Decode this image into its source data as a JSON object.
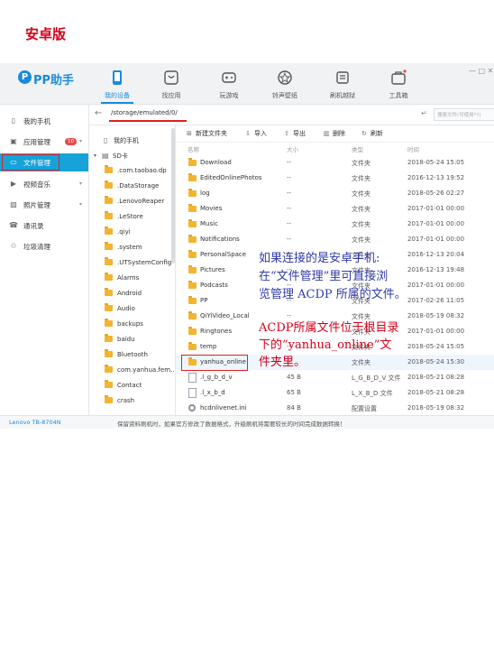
{
  "header": {
    "logo_letter": "P",
    "app_name": "PP助手",
    "edition_overlay": "安卓版",
    "nav": [
      {
        "label": "我的设备",
        "icon": "phone-icon",
        "active": true
      },
      {
        "label": "找应用",
        "icon": "app-store-icon",
        "active": false
      },
      {
        "label": "玩游戏",
        "icon": "gamepad-icon",
        "active": false
      },
      {
        "label": "铃声壁纸",
        "icon": "ringtone-icon",
        "active": false
      },
      {
        "label": "刷机越狱",
        "icon": "flash-icon",
        "active": false
      },
      {
        "label": "工具箱",
        "icon": "toolbox-icon",
        "active": false
      }
    ],
    "window_controls": "— □ ✕"
  },
  "sidebar": {
    "items": [
      {
        "label": "我的手机",
        "icon": "phone-icon"
      },
      {
        "label": "应用管理",
        "icon": "apps-icon",
        "badge": "10"
      },
      {
        "label": "文件管理",
        "icon": "folder-icon",
        "active": true
      },
      {
        "label": "视频音乐",
        "icon": "video-icon"
      },
      {
        "label": "照片管理",
        "icon": "photo-icon"
      },
      {
        "label": "通讯录",
        "icon": "contacts-icon"
      },
      {
        "label": "垃圾清理",
        "icon": "cleanup-icon"
      }
    ]
  },
  "pathbar": {
    "back": "←",
    "path": "/storage/emulated/0/",
    "enter": "↵",
    "search_placeholder": "搜索文件(可使用*?)"
  },
  "tree": {
    "my_phone": "我的手机",
    "sd_card": "SD卡",
    "folders": [
      ".com.taobao.dp",
      ".DataStorage",
      ".LenovoReaper",
      ".LeStore",
      ".qiyi",
      ".system",
      ".UTSystemConfig",
      "Alarms",
      "Android",
      "Audio",
      "backups",
      "baidu",
      "Bluetooth",
      "com.yanhua.fem...",
      "Contact",
      "crash"
    ]
  },
  "toolbar": {
    "new_folder": "新建文件夹",
    "import": "导入",
    "export": "导出",
    "delete": "删除",
    "refresh": "刷新"
  },
  "list": {
    "headers": {
      "name": "名称",
      "size": "大小",
      "type": "类型",
      "time": "时间"
    },
    "rows": [
      {
        "name": "Download",
        "size": "--",
        "type": "文件夹",
        "time": "2018-05-24 15:05",
        "kind": "folder"
      },
      {
        "name": "EditedOnlinePhotos",
        "size": "--",
        "type": "文件夹",
        "time": "2016-12-13 19:52",
        "kind": "folder"
      },
      {
        "name": "log",
        "size": "--",
        "type": "文件夹",
        "time": "2018-05-26 02:27",
        "kind": "folder"
      },
      {
        "name": "Movies",
        "size": "--",
        "type": "文件夹",
        "time": "2017-01-01 00:00",
        "kind": "folder"
      },
      {
        "name": "Music",
        "size": "--",
        "type": "文件夹",
        "time": "2017-01-01 00:00",
        "kind": "folder"
      },
      {
        "name": "Notifications",
        "size": "--",
        "type": "文件夹",
        "time": "2017-01-01 00:00",
        "kind": "folder"
      },
      {
        "name": "PersonalSpace",
        "size": "--",
        "type": "文件夹",
        "time": "2016-12-13 20:04",
        "kind": "folder"
      },
      {
        "name": "Pictures",
        "size": "--",
        "type": "文件夹",
        "time": "2016-12-13 19:48",
        "kind": "folder"
      },
      {
        "name": "Podcasts",
        "size": "--",
        "type": "文件夹",
        "time": "2017-01-01 00:00",
        "kind": "folder"
      },
      {
        "name": "PP",
        "size": "--",
        "type": "文件夹",
        "time": "2017-02-26 11:05",
        "kind": "folder"
      },
      {
        "name": "QiYiVideo_Local",
        "size": "--",
        "type": "文件夹",
        "time": "2018-05-19 08:32",
        "kind": "folder"
      },
      {
        "name": "Ringtones",
        "size": "--",
        "type": "文件夹",
        "time": "2017-01-01 00:00",
        "kind": "folder"
      },
      {
        "name": "temp",
        "size": "--",
        "type": "文件夹",
        "time": "2018-05-24 15:05",
        "kind": "folder"
      },
      {
        "name": "yanhua_online",
        "size": "--",
        "type": "文件夹",
        "time": "2018-05-24 15:30",
        "kind": "folder",
        "highlight": true
      },
      {
        "name": ".l_g_b_d_v",
        "size": "45 B",
        "type": "L_G_B_D_V 文件",
        "time": "2018-05-21 08:28",
        "kind": "file"
      },
      {
        "name": ".l_x_b_d",
        "size": "65 B",
        "type": "L_X_B_D 文件",
        "time": "2018-05-21 08:28",
        "kind": "file"
      },
      {
        "name": "hcdnlivenet.ini",
        "size": "84 B",
        "type": "配置设置",
        "time": "2018-05-19 08:32",
        "kind": "ini"
      }
    ]
  },
  "status": {
    "device": "Lenovo TB-8704N",
    "message": "保留资料刷机时，如果官方修改了数据格式，升级刷机将需要较长的时间完成数据转换！"
  },
  "annotations": {
    "note1_lines": [
      "如果连接的是安卓手机:",
      "在“文件管理”里可直接浏",
      "览管理 ACDP 所属的文件。"
    ],
    "note2_lines": [
      "ACDP所属文件位于根目录",
      "下的“yanhua_online”文",
      "件夹里。"
    ]
  },
  "colors": {
    "accent": "#1a8bdc",
    "active_sidebar": "#17a2d8",
    "highlight_red": "#e02020",
    "note_blue": "#2f3aa8",
    "note_red": "#d4001a",
    "folder": "#f2b531"
  }
}
